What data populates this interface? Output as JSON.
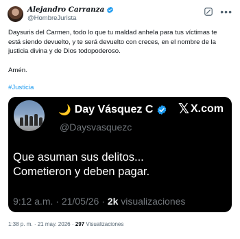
{
  "author": {
    "display_name": "Alejandro Carranza",
    "handle": "@HombreJurista",
    "verified": true,
    "badge_color": "#1d9bf0"
  },
  "header_icons": [
    "grok-icon",
    "more-icon"
  ],
  "tweet": {
    "text": "Daysuris del Carmen, todo lo que tu maldad anhela para tus víctimas te está siendo devuelto, y te será devuelto con creces, en el nombre de la justicia divina y de Dios todopoderoso.",
    "closing": "Amén.",
    "hashtag": "#Justicia",
    "hashtag_color": "#1d9bf0",
    "time": "1:38 p. m.",
    "date": "21 may. 2026",
    "views_count": "297",
    "views_label": "Visualizaciones"
  },
  "embedded": {
    "emoji": "🌙",
    "display_name": "Day Vásquez C",
    "handle": "@Daysvasquezc",
    "verified": true,
    "brand": "X.com",
    "brand_icon": "𝕏",
    "line1": "Que asuman sus delitos...",
    "line2": "Cometieron y deben pagar.",
    "time": "9:12 a.m.",
    "date": "21/05/26",
    "views_count": "2k",
    "views_label": "visualizaciones",
    "background": "#000000"
  },
  "separators": {
    "dot": "·"
  }
}
